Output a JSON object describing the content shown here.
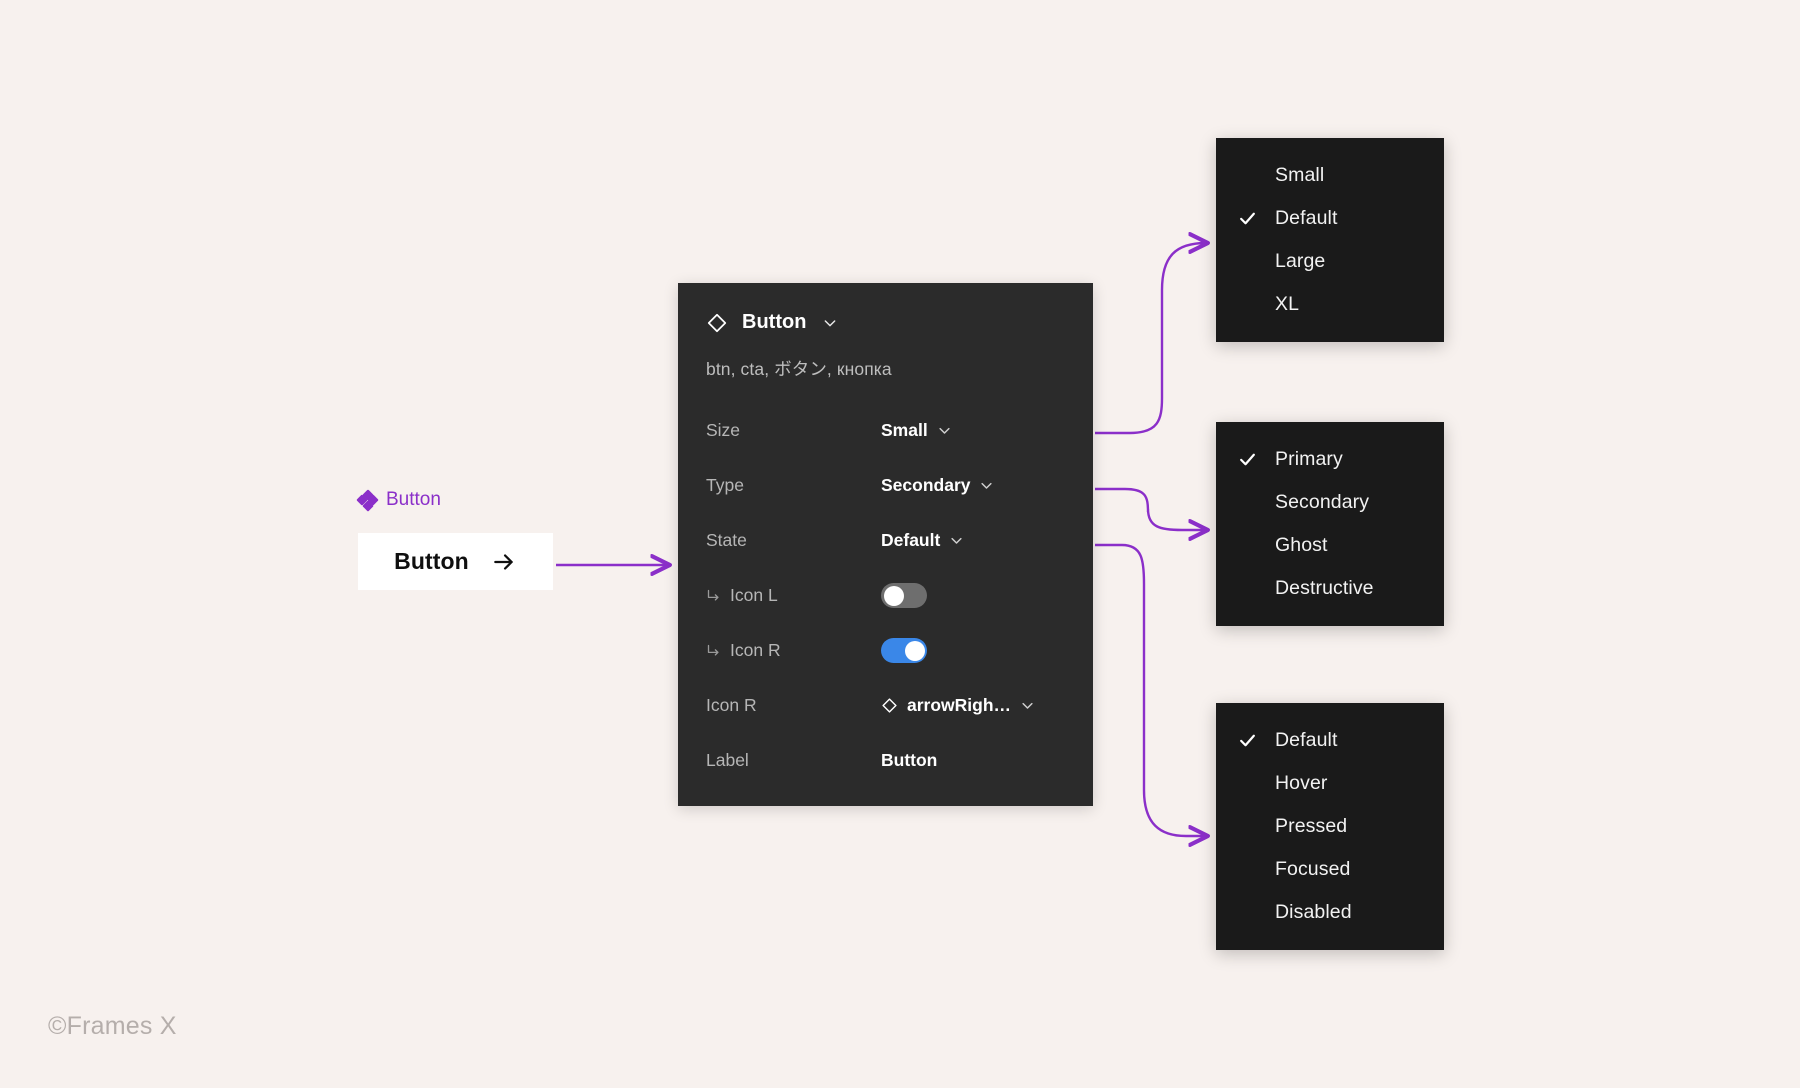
{
  "canvas": {
    "background": "#f7f1ee",
    "accent": "#8b2fc9"
  },
  "component_badge": {
    "label": "Button",
    "icon": "component-diamonds-icon",
    "color": "#8b2fc9"
  },
  "preview_button": {
    "label": "Button",
    "icon_right": "arrow-right-icon",
    "background": "#ffffff",
    "text_color": "#0f0f0f"
  },
  "panel": {
    "title": "Button",
    "title_icon": "component-diamond-icon",
    "collapse_icon": "chevron-down-icon",
    "keywords": "btn, cta, ボタン, кнопка",
    "background": "#2b2b2b",
    "rows": [
      {
        "label": "Size",
        "control": "select",
        "value": "Small",
        "icon": null,
        "indent": false
      },
      {
        "label": "Type",
        "control": "select",
        "value": "Secondary",
        "icon": null,
        "indent": false
      },
      {
        "label": "State",
        "control": "select",
        "value": "Default",
        "icon": null,
        "indent": false
      },
      {
        "label": "Icon L",
        "control": "toggle",
        "value": "off",
        "icon": null,
        "indent": true
      },
      {
        "label": "Icon R",
        "control": "toggle",
        "value": "on",
        "icon": null,
        "indent": true
      },
      {
        "label": "Icon R",
        "control": "select",
        "value": "arrowRigh…",
        "icon": "component-diamond-icon",
        "indent": false
      },
      {
        "label": "Label",
        "control": "text",
        "value": "Button",
        "icon": null,
        "indent": false
      }
    ]
  },
  "menus": {
    "size": {
      "name": "size-menu",
      "items": [
        {
          "label": "Small",
          "checked": false
        },
        {
          "label": "Default",
          "checked": true
        },
        {
          "label": "Large",
          "checked": false
        },
        {
          "label": "XL",
          "checked": false
        }
      ]
    },
    "type": {
      "name": "type-menu",
      "items": [
        {
          "label": "Primary",
          "checked": true
        },
        {
          "label": "Secondary",
          "checked": false
        },
        {
          "label": "Ghost",
          "checked": false
        },
        {
          "label": "Destructive",
          "checked": false
        }
      ]
    },
    "state": {
      "name": "state-menu",
      "items": [
        {
          "label": "Default",
          "checked": true
        },
        {
          "label": "Hover",
          "checked": false
        },
        {
          "label": "Pressed",
          "checked": false
        },
        {
          "label": "Focused",
          "checked": false
        },
        {
          "label": "Disabled",
          "checked": false
        }
      ]
    }
  },
  "watermark": {
    "text": "©Frames X"
  }
}
